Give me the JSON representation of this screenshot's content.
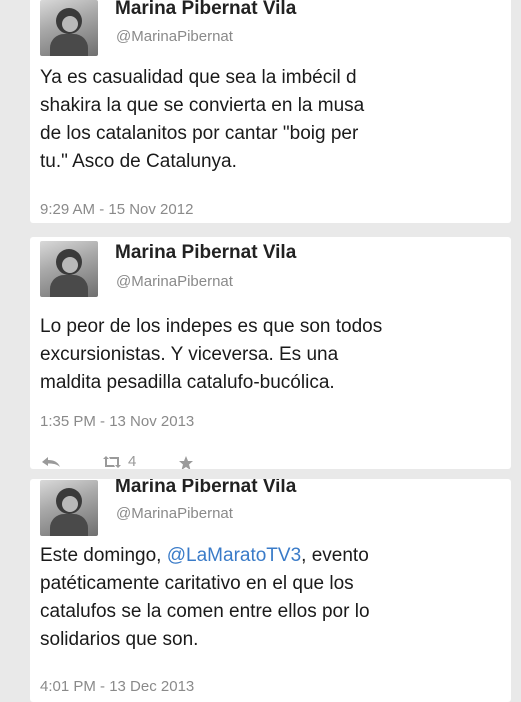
{
  "tweets": [
    {
      "name": "Marina Pibernat Vila",
      "handle": "@MarinaPibernat",
      "text": "Ya es casualidad que sea la imbécil d shakira la que se convierta en la musa de los catalanitos por cantar \"boig per tu.\" Asco de Catalunya.",
      "lines": [
        "Ya es casualidad que sea la imbécil d",
        "shakira la que se convierta en la musa",
        "de los catalanitos por cantar \"boig per",
        "tu.\" Asco de Catalunya."
      ],
      "time": "9:29 AM - 15 Nov 2012"
    },
    {
      "name": "Marina Pibernat Vila",
      "handle": "@MarinaPibernat",
      "lines": [
        "Lo peor de los indepes es que son todos",
        "excursionistas. Y viceversa. Es una",
        "maldita pesadilla catalufo-bucólica."
      ],
      "time": "1:35 PM - 13 Nov 2013",
      "retweet_count": "4"
    },
    {
      "name": "Marina Pibernat Vila",
      "handle": "@MarinaPibernat",
      "line1_prefix": "Este domingo, ",
      "mention": "@LaMaratoTV3",
      "line1_suffix": ", evento",
      "lines_rest": [
        "patéticamente caritativo en el que los",
        "catalufos se la comen entre ellos por lo",
        "solidarios que son."
      ],
      "time": "4:01 PM - 13 Dec 2013"
    }
  ],
  "colors": {
    "link": "#3a7bc8",
    "muted": "#8a8a8a",
    "background": "#e9e9e9"
  },
  "icons": [
    "reply-icon",
    "retweet-icon",
    "favorite-icon"
  ]
}
